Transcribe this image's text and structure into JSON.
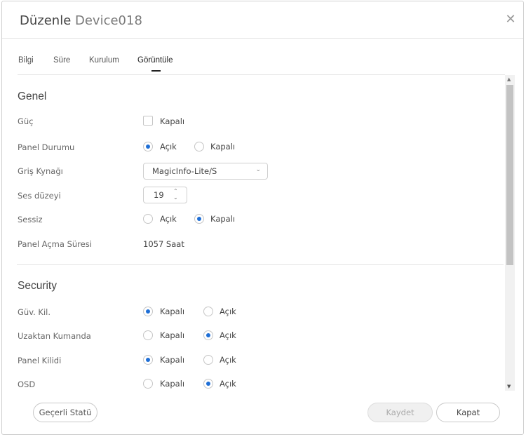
{
  "dialog": {
    "title": "Düzenle",
    "device": "Device018",
    "close_icon": "close-icon"
  },
  "tabs": [
    {
      "label": "Bilgi"
    },
    {
      "label": "Süre"
    },
    {
      "label": "Kurulum"
    },
    {
      "label": "Görüntüle",
      "active": true
    }
  ],
  "general": {
    "title": "Genel",
    "power": {
      "label": "Güç",
      "option": "Kapalı",
      "checked": false
    },
    "panel_status": {
      "label": "Panel Durumu",
      "options": [
        "Açık",
        "Kapalı"
      ],
      "selected": "Açık"
    },
    "input_source": {
      "label": "Griş Kynağı",
      "value": "MagicInfo-Lite/S"
    },
    "volume": {
      "label": "Ses düzeyi",
      "value": "19"
    },
    "mute": {
      "label": "Sessiz",
      "options": [
        "Açık",
        "Kapalı"
      ],
      "selected": "Kapalı"
    },
    "panel_on_time": {
      "label": "Panel Açma Süresi",
      "value": "1057 Saat"
    }
  },
  "security": {
    "title": "Security",
    "safety_lock": {
      "label": "Güv. Kil.",
      "options": [
        "Kapalı",
        "Açık"
      ],
      "selected": "Kapalı"
    },
    "remote_control": {
      "label": "Uzaktan Kumanda",
      "options": [
        "Kapalı",
        "Açık"
      ],
      "selected": "Açık"
    },
    "panel_lock": {
      "label": "Panel Kilidi",
      "options": [
        "Kapalı",
        "Açık"
      ],
      "selected": "Kapalı"
    },
    "osd": {
      "label": "OSD",
      "options": [
        "Kapalı",
        "Açık"
      ],
      "selected": "Açık"
    }
  },
  "footer": {
    "status_button": "Geçerli Statü",
    "save_button": "Kaydet",
    "close_button": "Kapat"
  },
  "colors": {
    "accent": "#1f6fd6",
    "border": "#cfcfcf"
  }
}
